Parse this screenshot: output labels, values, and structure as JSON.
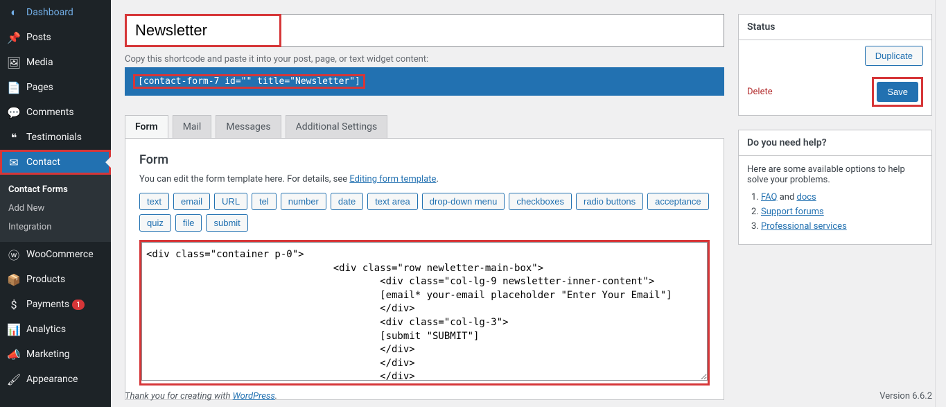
{
  "sidebar": {
    "items": [
      {
        "icon": "◐",
        "label": "Dashboard"
      },
      {
        "icon": "📌",
        "label": "Posts"
      },
      {
        "icon": "🖼",
        "label": "Media"
      },
      {
        "icon": "📄",
        "label": "Pages"
      },
      {
        "icon": "💬",
        "label": "Comments"
      },
      {
        "icon": "❝",
        "label": "Testimonials"
      },
      {
        "icon": "✉",
        "label": "Contact"
      },
      {
        "icon": "ⓦ",
        "label": "WooCommerce"
      },
      {
        "icon": "📦",
        "label": "Products"
      },
      {
        "icon": "$",
        "label": "Payments",
        "badge": "1"
      },
      {
        "icon": "📊",
        "label": "Analytics"
      },
      {
        "icon": "📣",
        "label": "Marketing"
      },
      {
        "icon": "🖌",
        "label": "Appearance"
      }
    ],
    "submenu": [
      {
        "label": "Contact Forms",
        "current": true
      },
      {
        "label": "Add New"
      },
      {
        "label": "Integration"
      }
    ]
  },
  "title": "Newsletter",
  "shortcode_hint": "Copy this shortcode and paste it into your post, page, or text widget content:",
  "shortcode": "[contact-form-7 id=\"\" title=\"Newsletter\"]",
  "tabs": [
    "Form",
    "Mail",
    "Messages",
    "Additional Settings"
  ],
  "form_panel": {
    "title": "Form",
    "desc_prefix": "You can edit the form template here. For details, see ",
    "desc_link": "Editing form template",
    "tags": [
      "text",
      "email",
      "URL",
      "tel",
      "number",
      "date",
      "text area",
      "drop-down menu",
      "checkboxes",
      "radio buttons",
      "acceptance",
      "quiz",
      "file",
      "submit"
    ],
    "code": "<div class=\"container p-0\">\n                                <div class=\"row newletter-main-box\">\n                                        <div class=\"col-lg-9 newsletter-inner-content\">\n                                        [email* your-email placeholder \"Enter Your Email\"]\n                                        </div>\n                                        <div class=\"col-lg-3\">\n                                        [submit \"SUBMIT\"]\n                                        </div>\n                                        </div>\n                                        </div>"
  },
  "status": {
    "title": "Status",
    "duplicate": "Duplicate",
    "delete": "Delete",
    "save": "Save"
  },
  "help": {
    "title": "Do you need help?",
    "intro": "Here are some available options to help solve your problems.",
    "faq": "FAQ",
    "and": " and ",
    "docs": "docs",
    "forums": "Support forums",
    "services": "Professional services"
  },
  "footer": {
    "thanks_prefix": "Thank you for creating with ",
    "wordpress": "WordPress",
    "version": "Version 6.6.2"
  }
}
